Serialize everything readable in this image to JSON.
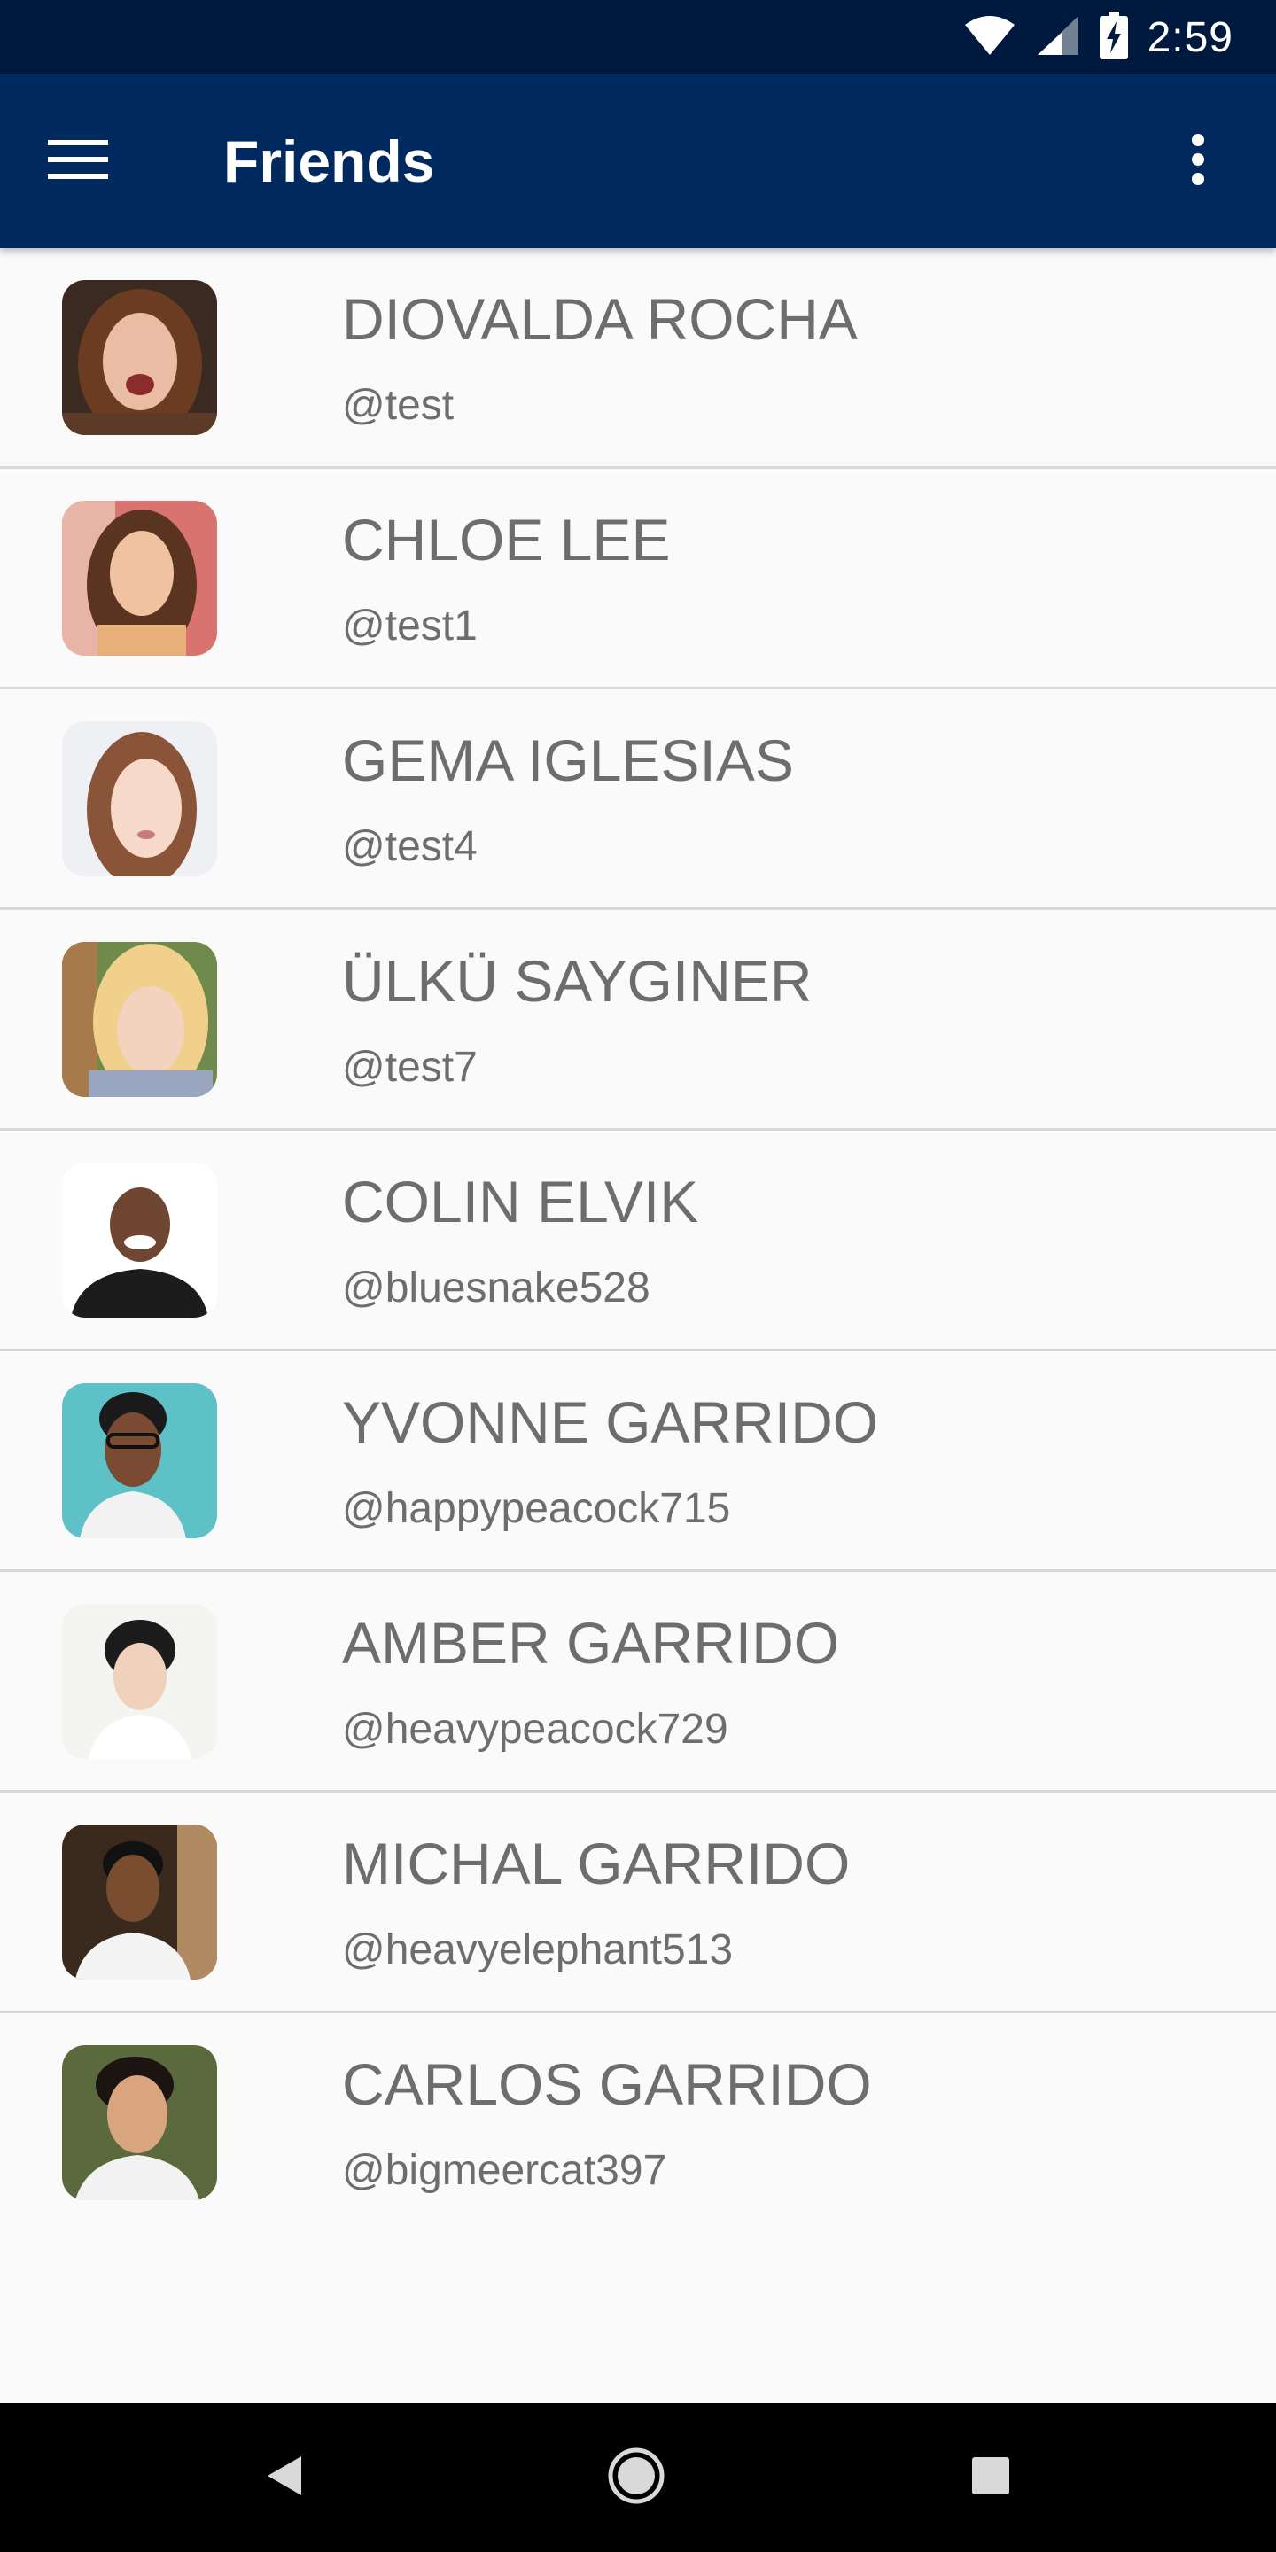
{
  "status_bar": {
    "time": "2:59",
    "icons": [
      "wifi-icon",
      "signal-icon",
      "battery-charging-icon"
    ]
  },
  "app_bar": {
    "menu_icon": "hamburger-menu-icon",
    "title": "Friends",
    "overflow_icon": "more-vertical-icon",
    "background_color": "#002a5f",
    "status_color": "#001a3f"
  },
  "friends": [
    {
      "name": "DIOVALDA ROCHA",
      "handle": "@test"
    },
    {
      "name": "CHLOE LEE",
      "handle": "@test1"
    },
    {
      "name": "GEMA IGLESIAS",
      "handle": "@test4"
    },
    {
      "name": "ÜLKÜ SAYGINER",
      "handle": "@test7"
    },
    {
      "name": "COLIN ELVIK",
      "handle": "@bluesnake528"
    },
    {
      "name": "YVONNE GARRIDO",
      "handle": "@happypeacock715"
    },
    {
      "name": "AMBER GARRIDO",
      "handle": "@heavypeacock729"
    },
    {
      "name": "MICHAL GARRIDO",
      "handle": "@heavyelephant513"
    },
    {
      "name": "CARLOS GARRIDO",
      "handle": "@bigmeercat397"
    }
  ],
  "nav_bar": {
    "icons": [
      "back-icon",
      "home-icon",
      "recents-icon"
    ]
  }
}
